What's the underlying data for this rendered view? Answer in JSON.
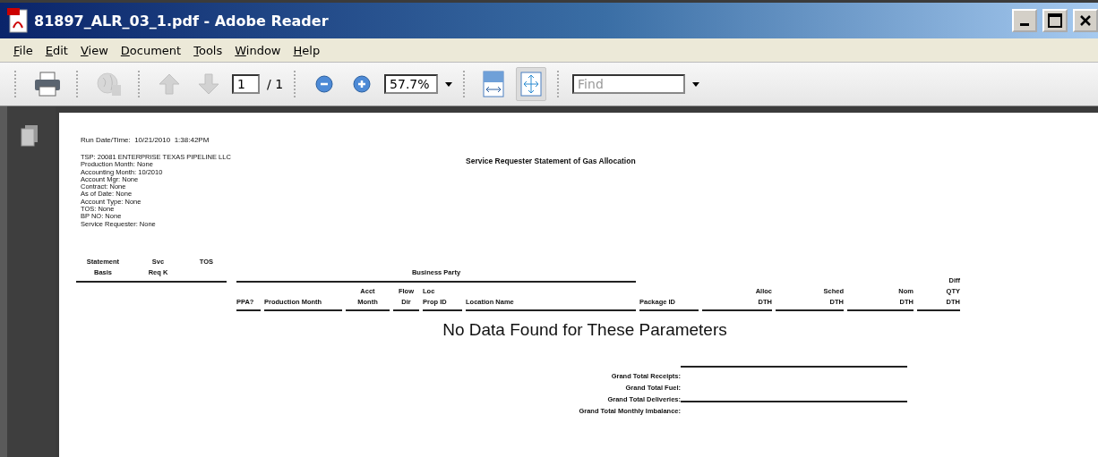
{
  "window": {
    "title": "81897_ALR_03_1.pdf - Adobe Reader"
  },
  "menu": [
    "File",
    "Edit",
    "View",
    "Document",
    "Tools",
    "Window",
    "Help"
  ],
  "toolbar": {
    "buttons": [
      {
        "kind": "print",
        "disabled": false
      },
      {
        "kind": "share",
        "disabled": true
      },
      {
        "kind": "previous",
        "disabled": true
      },
      {
        "kind": "next",
        "disabled": true
      }
    ],
    "page_value": "1",
    "page_total": "/ 1",
    "zoom_value": "57.7%",
    "view_buttons": [
      {
        "kind": "fit-width",
        "selected": false
      },
      {
        "kind": "fit-page",
        "selected": true
      }
    ],
    "find_placeholder": "Find"
  },
  "document": {
    "run_datetime": "Run Date/Time:  10/21/2010  1:38:42PM",
    "parameters": [
      "TSP: 20081 ENTERPRISE TEXAS PIPELINE LLC",
      "Production Month: None",
      "Accounting Month: 10/2010",
      "Account Mgr: None",
      "Contract: None",
      "As of Date: None",
      "Account Type: None",
      "TOS: None",
      "BP NO: None",
      "Service Requester: None"
    ],
    "title": "Service Requester Statement of Gas Allocation",
    "top_columns": [
      "Statement\nBasis",
      "Svc\nReq K",
      "TOS"
    ],
    "group_header": "Business Party",
    "columns": [
      "PPA?",
      "Production Month",
      "Acct\nMonth",
      "Flow\nDir",
      "Loc\nProp ID",
      "Location Name",
      "Package ID",
      "Alloc\nDTH",
      "Sched\nDTH",
      "Nom\nDTH",
      "Diff\nQTY\nDTH"
    ],
    "message": "No Data Found for These Parameters",
    "totals": [
      {
        "label": "Grand Total Receipts:",
        "rule_above": true
      },
      {
        "label": "Grand Total Fuel:",
        "rule_above": false
      },
      {
        "label": "Grand Total Deliveries:",
        "rule_above": false
      },
      {
        "label": "Grand Total Monthly Imbalance:",
        "rule_above": true
      }
    ]
  }
}
